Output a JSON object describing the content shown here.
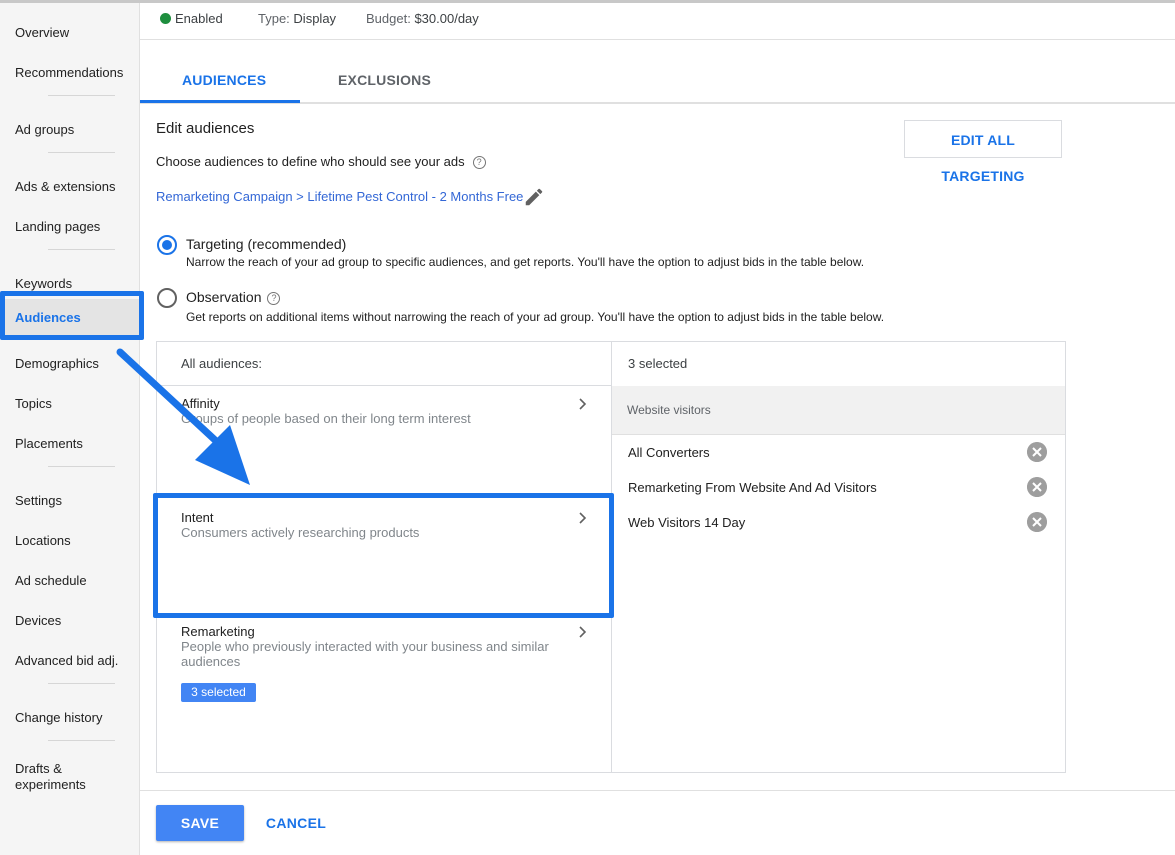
{
  "sidebar": {
    "items": [
      {
        "label": "Overview"
      },
      {
        "label": "Recommendations"
      },
      {
        "label": "Ad groups"
      },
      {
        "label": "Ads & extensions"
      },
      {
        "label": "Landing pages"
      },
      {
        "label": "Keywords"
      },
      {
        "label": "Audiences",
        "active": true
      },
      {
        "label": "Demographics"
      },
      {
        "label": "Topics"
      },
      {
        "label": "Placements"
      },
      {
        "label": "Settings"
      },
      {
        "label": "Locations"
      },
      {
        "label": "Ad schedule"
      },
      {
        "label": "Devices"
      },
      {
        "label": "Advanced bid adj."
      },
      {
        "label": "Change history"
      },
      {
        "label": "Drafts & experiments"
      }
    ]
  },
  "status": {
    "enabled": "Enabled",
    "type_label": "Type:",
    "type_value": "Display",
    "budget_label": "Budget:",
    "budget_value": "$30.00/day"
  },
  "tabs": [
    {
      "label": "AUDIENCES",
      "active": true
    },
    {
      "label": "EXCLUSIONS"
    }
  ],
  "main": {
    "title": "Edit audiences",
    "subtitle": "Choose audiences to define who should see your ads",
    "help_glyph": "?",
    "edit_all_label": "EDIT ALL TARGETING",
    "breadcrumb": "Remarketing Campaign > Lifetime Pest Control - 2 Months Free"
  },
  "options": [
    {
      "title": "Targeting (recommended)",
      "desc": "Narrow the reach of your ad group to specific audiences, and get reports. You'll have the option to adjust bids in the table below.",
      "checked": true
    },
    {
      "title": "Observation",
      "desc": "Get reports on additional items without narrowing the reach of your ad group. You'll have the option to adjust bids in the table below.",
      "checked": false
    }
  ],
  "audience_table": {
    "left_header": "All audiences:",
    "right_header": "3 selected",
    "categories": [
      {
        "title": "Affinity",
        "desc": "Groups of people based on their long term interest"
      },
      {
        "title": "Intent",
        "desc": "Consumers actively researching products"
      },
      {
        "title": "Remarketing",
        "desc": "People who previously interacted with your business and similar audiences",
        "badge": "3 selected"
      }
    ],
    "group_label": "Website visitors",
    "selected": [
      {
        "label": "All Converters"
      },
      {
        "label": "Remarketing From Website And Ad Visitors"
      },
      {
        "label": "Web Visitors 14 Day"
      }
    ]
  },
  "footer": {
    "save_label": "SAVE",
    "cancel_label": "CANCEL"
  },
  "colors": {
    "accent": "#1a73e8",
    "status_enabled": "#1e8e3e",
    "badge": "#4285f4"
  }
}
